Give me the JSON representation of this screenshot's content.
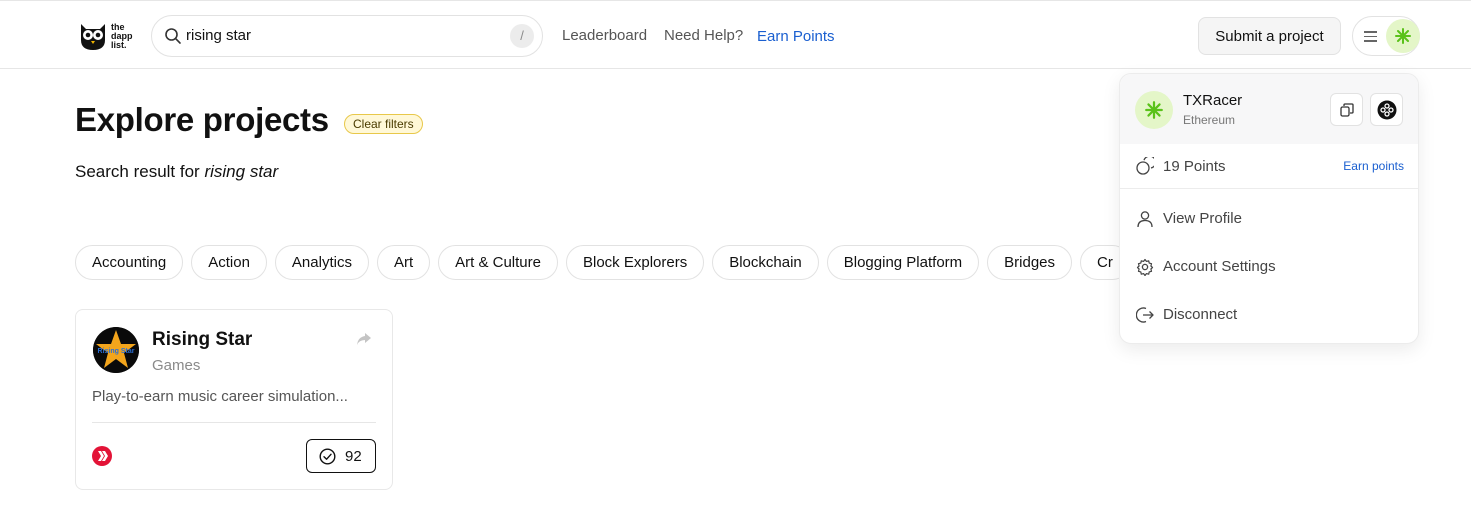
{
  "header": {
    "logo_lines": [
      "the",
      "dapp",
      "list."
    ],
    "search": {
      "value": "rising star",
      "shortcut": "/"
    },
    "nav": {
      "leaderboard": "Leaderboard",
      "help": "Need Help?",
      "earn": "Earn Points"
    },
    "submit_label": "Submit a project"
  },
  "main": {
    "title": "Explore projects",
    "clear_filters": "Clear filters",
    "search_result_prefix": "Search result for",
    "search_term": "rising star",
    "categories": [
      "Accounting",
      "Action",
      "Analytics",
      "Art",
      "Art & Culture",
      "Block Explorers",
      "Blockchain",
      "Blogging Platform",
      "Bridges",
      "Cr"
    ]
  },
  "card": {
    "logo_text": "Rising Star",
    "title": "Rising Star",
    "category": "Games",
    "description": "Play-to-earn music career simulation...",
    "votes": "92"
  },
  "account_menu": {
    "name": "TXRacer",
    "chain": "Ethereum",
    "points": "19 Points",
    "earn_points": "Earn points",
    "items": [
      {
        "label": "View Profile",
        "icon": "user-icon"
      },
      {
        "label": "Account Settings",
        "icon": "gear-icon"
      },
      {
        "label": "Disconnect",
        "icon": "logout-icon"
      }
    ]
  },
  "colors": {
    "accent_blue": "#1a5fd0",
    "badge_yellow": "#fff8d7",
    "avatar_green": "#e4f6c8",
    "hive_red": "#e31337"
  }
}
